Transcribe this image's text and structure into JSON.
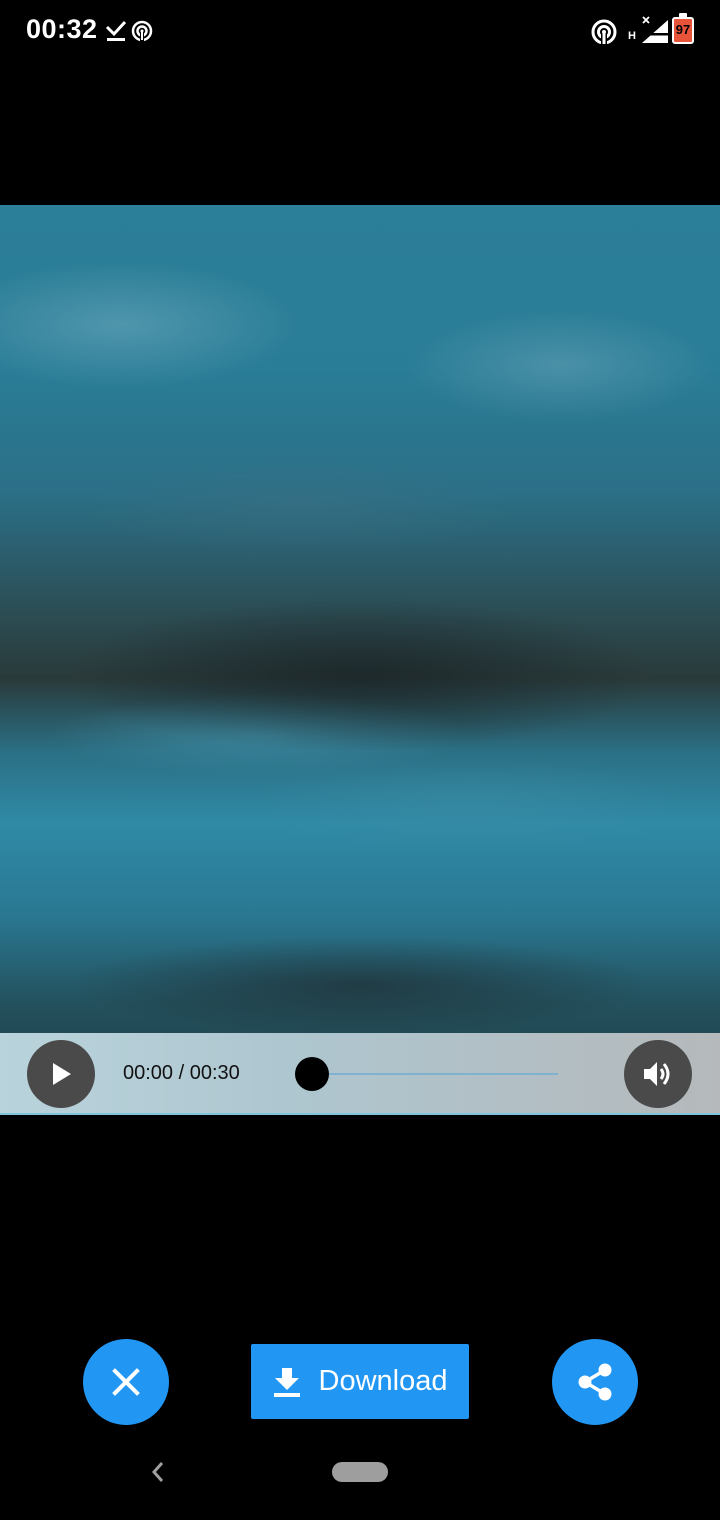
{
  "status_bar": {
    "time": "00:32",
    "battery_level": "97",
    "network_type": "H",
    "icons": [
      "download-done-icon",
      "hotspot-icon",
      "hotspot-icon",
      "signal-icon",
      "battery-icon"
    ]
  },
  "video": {
    "time_display": "00:00 / 00:30",
    "progress": 0.0,
    "icons": [
      "play-icon",
      "volume-icon"
    ]
  },
  "actions": {
    "download_label": "Download",
    "icons": [
      "close-icon",
      "download-icon",
      "share-icon"
    ],
    "accent_color": "#2196f3"
  },
  "nav_bar": {
    "icons": [
      "back-icon",
      "home-pill"
    ]
  }
}
